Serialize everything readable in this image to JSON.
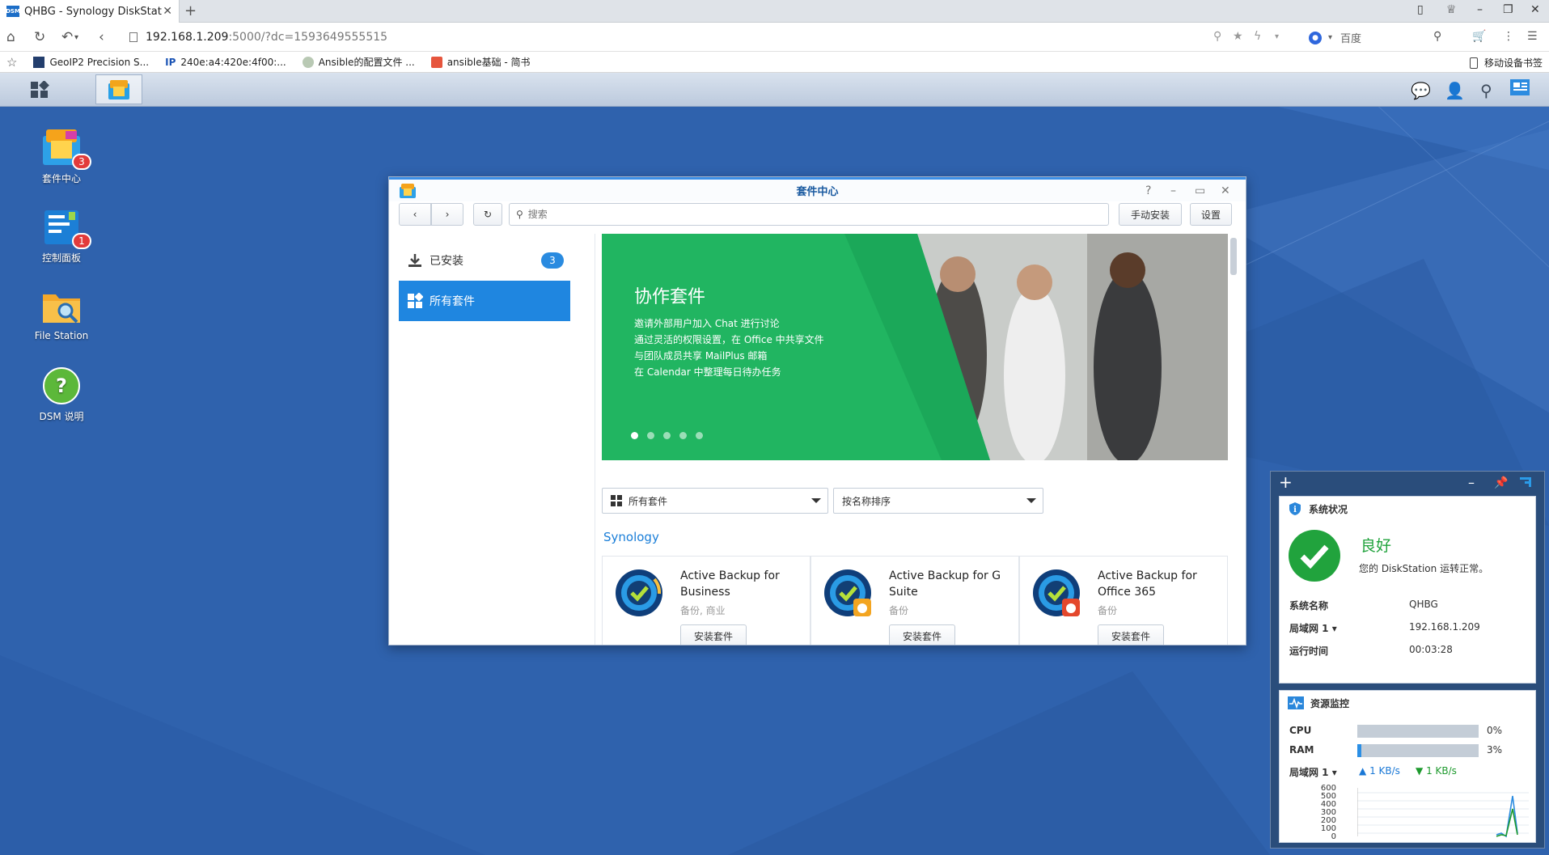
{
  "browser": {
    "tab_title": "QHBG - Synology DiskStation",
    "tab_favicon": "DSM",
    "url_host": "192.168.1.209",
    "url_rest": ":5000/?dc=1593649555515",
    "search_engine": "百度",
    "bookmarks": [
      {
        "label": "GeoIP2 Precision S...",
        "icon": "geoip-icon"
      },
      {
        "label": "240e:a4:420e:4f00:...",
        "icon": "ip-icon"
      },
      {
        "label": "Ansible的配置文件 ...",
        "icon": "frog-icon"
      },
      {
        "label": "ansible基础 - 简书",
        "icon": "jianshu-icon"
      }
    ],
    "mobile_bookmarks": "移动设备书签"
  },
  "desktop": {
    "icons": [
      {
        "label": "套件中心",
        "badge": "3"
      },
      {
        "label": "控制面板",
        "badge": "1"
      },
      {
        "label": "File Station"
      },
      {
        "label": "DSM 说明"
      }
    ]
  },
  "window": {
    "title": "套件中心",
    "search_placeholder": "搜索",
    "manual_install": "手动安装",
    "settings": "设置",
    "sidebar": [
      {
        "label": "已安装",
        "badge": "3"
      },
      {
        "label": "所有套件"
      }
    ],
    "banner": {
      "title": "协作套件",
      "lines": [
        "邀请外部用户加入 Chat 进行讨论",
        "通过灵活的权限设置，在 Office 中共享文件",
        "与团队成员共享 MailPlus 邮箱",
        "在 Calendar 中整理每日待办任务"
      ],
      "active_dot": 1,
      "dot_count": 5
    },
    "filter": "所有套件",
    "sort": "按名称排序",
    "section": "Synology",
    "packages": [
      {
        "name": "Active Backup for Business",
        "category": "备份, 商业",
        "button": "安装套件"
      },
      {
        "name": "Active Backup for G Suite",
        "category": "备份",
        "button": "安装套件"
      },
      {
        "name": "Active Backup for Office 365",
        "category": "备份",
        "button": "安装套件"
      }
    ]
  },
  "widgets": {
    "status": {
      "title": "系统状况",
      "state": "良好",
      "message": "您的 DiskStation 运转正常。",
      "rows": [
        {
          "label": "系统名称",
          "value": "QHBG"
        },
        {
          "label": "局域网 1 ▾",
          "value": "192.168.1.209"
        },
        {
          "label": "运行时间",
          "value": "00:03:28"
        }
      ]
    },
    "monitor": {
      "title": "资源监控",
      "cpu_label": "CPU",
      "cpu_value": "0%",
      "cpu_fraction": 0.0,
      "ram_label": "RAM",
      "ram_value": "3%",
      "ram_fraction": 0.03,
      "lan_label": "局域网 1 ▾",
      "upload": "1 KB/s",
      "download": "1 KB/s",
      "y_ticks": [
        "600",
        "500",
        "400",
        "300",
        "200",
        "100",
        "0"
      ]
    }
  },
  "colors": {
    "accent": "#1f86e0",
    "desktop": "#2f62ad",
    "banner_green": "#21b561",
    "ok_green": "#21a33d"
  }
}
